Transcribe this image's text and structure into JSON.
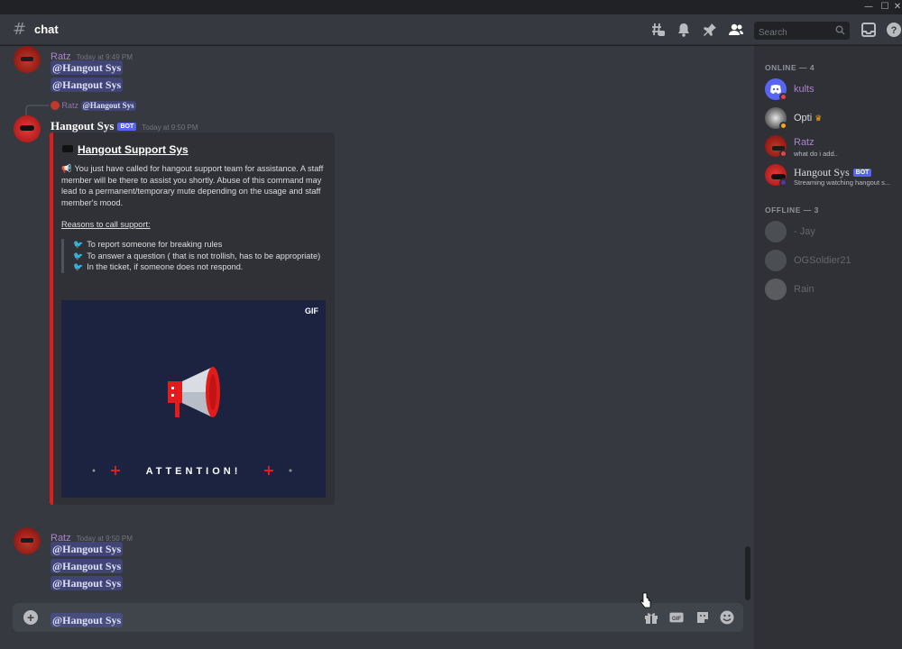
{
  "window": {
    "minimize": "—",
    "maximize": "☐",
    "close": "✕"
  },
  "header": {
    "channel_name": "chat",
    "search_placeholder": "Search"
  },
  "messages": {
    "m1": {
      "author": "Ratz",
      "timestamp": "Today at 9:49 PM",
      "lines": [
        "@Hangout Sys",
        "@Hangout Sys"
      ]
    },
    "m2": {
      "reply_author": "Ratz",
      "reply_mention": "@Hangout Sys",
      "author": "Hangout Sys",
      "badge": "BOT",
      "timestamp": "Today at 9:50 PM",
      "embed": {
        "author": "Hangout Support Sys",
        "description": "You just have called for hangout support team for assistance. A staff member will be there to assist you shortly. Abuse of this command may lead to a permanent/temporary mute depending on the usage and staff member's mood.",
        "reasons_title": "Reasons to call support:",
        "reasons": [
          "To report someone for breaking rules",
          "To answer a question ( that is not trollish, has to be appropriate)",
          "In the ticket, if someone does not respond."
        ],
        "gif_label": "GIF",
        "gif_caption": "ATTENTION!",
        "accent_color": "#e21b1b"
      }
    },
    "m3": {
      "author": "Ratz",
      "timestamp": "Today at 9:50 PM",
      "lines": [
        "@Hangout Sys",
        "@Hangout Sys",
        "@Hangout Sys"
      ]
    }
  },
  "composer": {
    "value": "@Hangout Sys"
  },
  "members": {
    "online_header": "ONLINE — 4",
    "online": [
      {
        "name": "kults",
        "status": "",
        "color": "#a883c9"
      },
      {
        "name": "Opti",
        "status": "",
        "color": "#dcddde"
      },
      {
        "name": "Ratz",
        "status": "what do i add..",
        "color": "#a883c9"
      },
      {
        "name": "Hangout Sys",
        "status": "Streaming watching hangout s...",
        "color": "#dcddde",
        "badge": "BOT"
      }
    ],
    "offline_header": "OFFLINE — 3",
    "offline": [
      {
        "name": "- Jay"
      },
      {
        "name": "OGSoldier21"
      },
      {
        "name": "Rain"
      }
    ]
  }
}
